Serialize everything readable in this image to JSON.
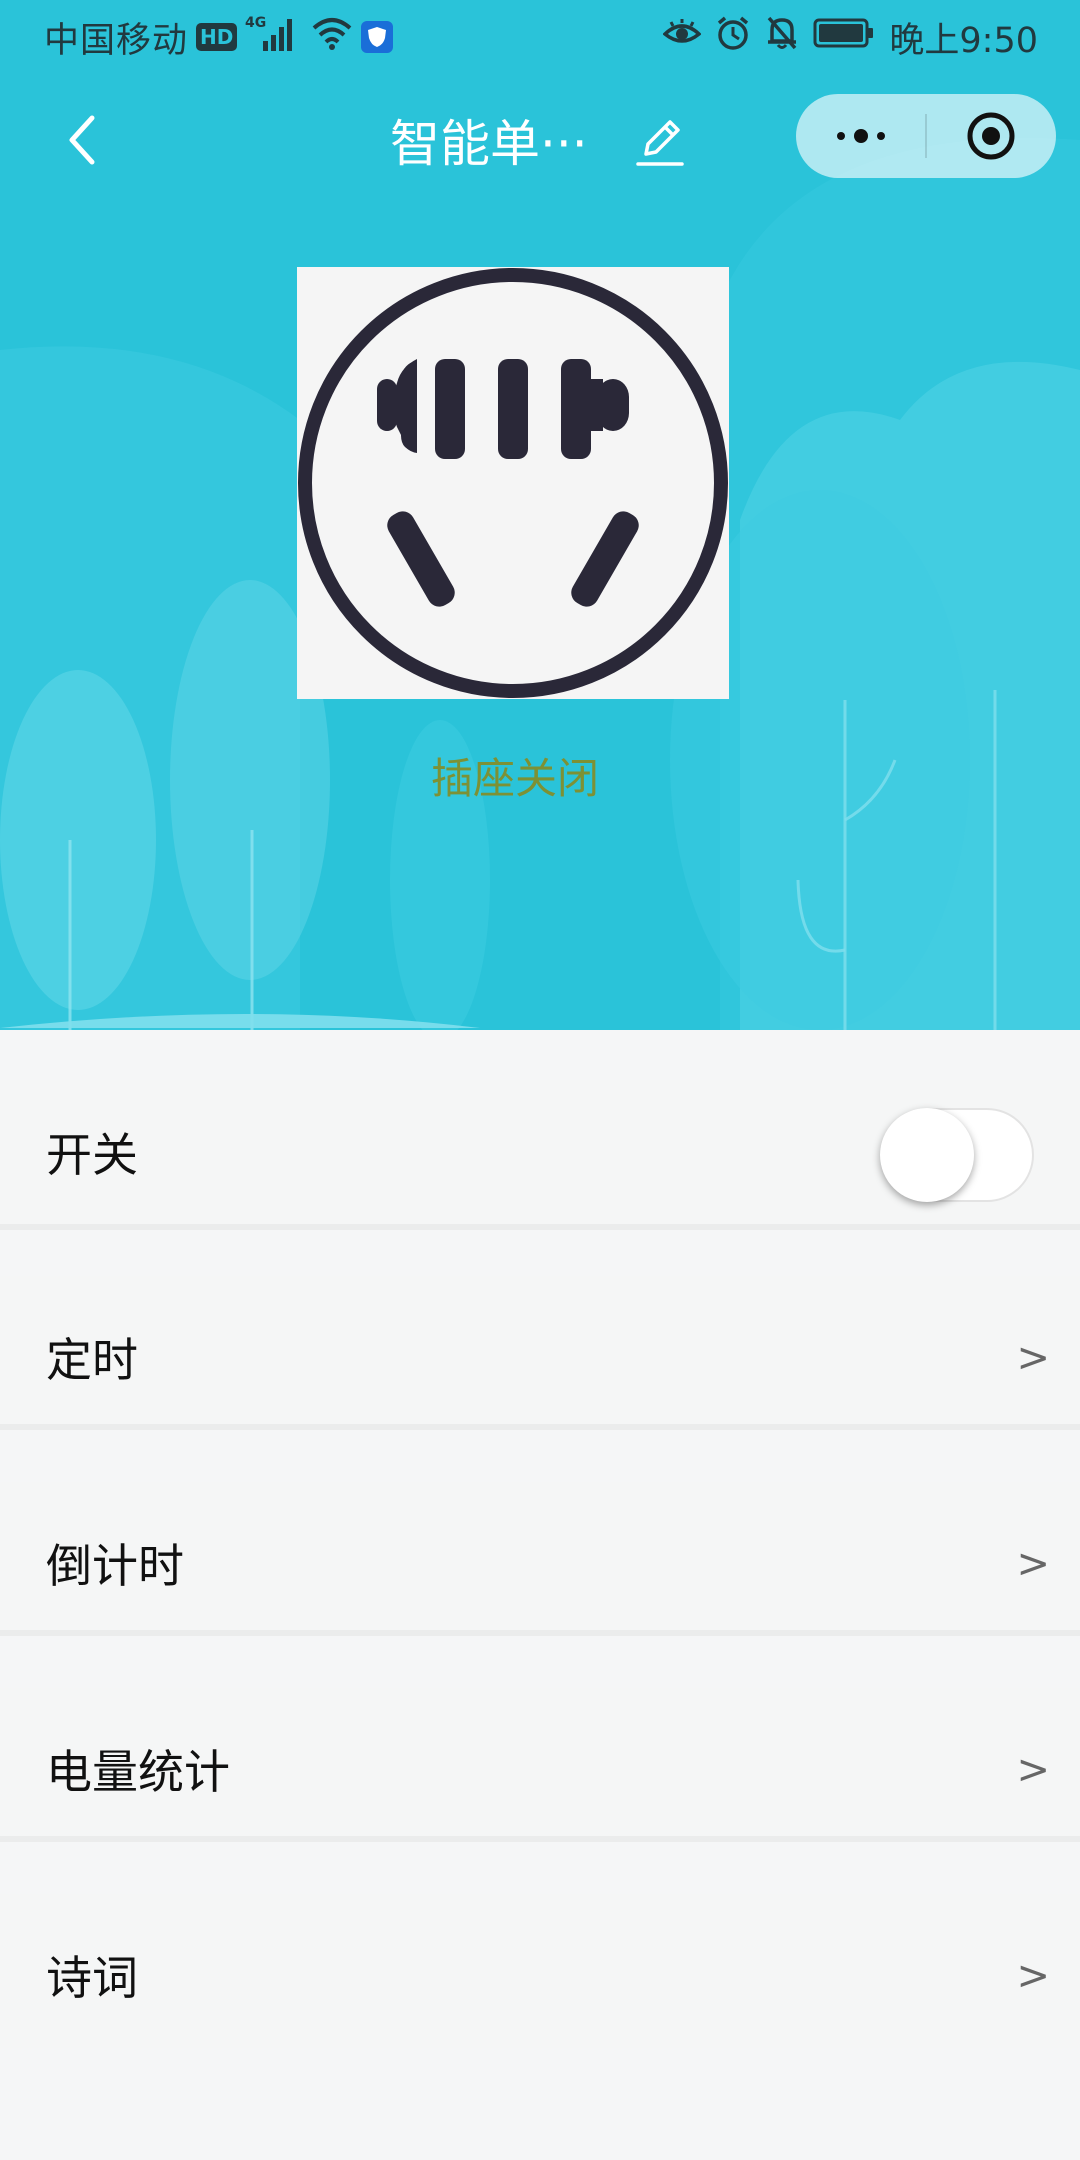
{
  "status_bar": {
    "carrier": "中国移动",
    "hd_badge": "HD",
    "network_type": "4G",
    "time": "晚上9:50",
    "icons": [
      "hd-icon",
      "signal-icon",
      "wifi-icon",
      "shield-icon",
      "eye-icon",
      "alarm-icon",
      "bell-muted-icon",
      "battery-icon"
    ]
  },
  "nav": {
    "title": "智能单···",
    "back_icon": "chevron-left-icon",
    "edit_icon": "pencil-icon",
    "more_icon": "more-dots-icon",
    "close_icon": "target-close-icon"
  },
  "device": {
    "image_icon": "power-socket-icon",
    "status_text": "插座关闭"
  },
  "list": {
    "switch_label": "开关",
    "switch_on": false,
    "items": [
      {
        "label": "定时",
        "chevron": ">"
      },
      {
        "label": "倒计时",
        "chevron": ">"
      },
      {
        "label": "电量统计",
        "chevron": ">"
      },
      {
        "label": "诗词",
        "chevron": ">"
      }
    ]
  },
  "colors": {
    "hero_bg": "#2ac3d9",
    "status_text": "#7d9135",
    "page_bg": "#f5f6f7"
  }
}
